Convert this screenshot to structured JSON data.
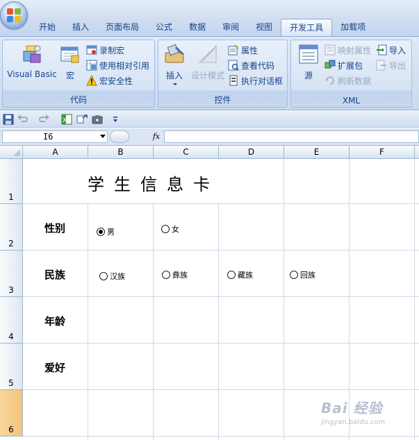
{
  "tabs": [
    "开始",
    "插入",
    "页面布局",
    "公式",
    "数据",
    "审阅",
    "视图",
    "开发工具",
    "加载项"
  ],
  "active_tab": "开发工具",
  "ribbon": {
    "code_group": {
      "label": "代码",
      "visual_basic": "Visual Basic",
      "macros": "宏",
      "record_macro": "录制宏",
      "relative_refs": "使用相对引用",
      "macro_security": "宏安全性"
    },
    "controls_group": {
      "label": "控件",
      "insert": "插入",
      "design_mode": "设计模式",
      "properties": "属性",
      "view_code": "查看代码",
      "run_dialog": "执行对话框"
    },
    "xml_group": {
      "label": "XML",
      "source": "源",
      "map_properties": "映射属性",
      "expansion_packs": "扩展包",
      "refresh_data": "刷新数据",
      "import": "导入",
      "export": "导出"
    }
  },
  "formula_bar": {
    "name_box": "I6",
    "fx": "fx",
    "formula": ""
  },
  "sheet": {
    "columns": [
      "A",
      "B",
      "C",
      "D",
      "E",
      "F"
    ],
    "rows": [
      "1",
      "2",
      "3",
      "4",
      "5",
      "6"
    ],
    "title": "学生信息卡",
    "labels": {
      "gender": "性别",
      "ethnicity": "民族",
      "age": "年龄",
      "hobby": "爱好"
    },
    "gender_options": [
      {
        "label": "男",
        "selected": true
      },
      {
        "label": "女",
        "selected": false
      }
    ],
    "ethnicity_options": [
      {
        "label": "汉族",
        "selected": false
      },
      {
        "label": "彝族",
        "selected": false
      },
      {
        "label": "藏族",
        "selected": false
      },
      {
        "label": "回族",
        "selected": false
      }
    ]
  },
  "watermark": {
    "logo": "Bai 经验",
    "url": "jingyan.baidu.com"
  }
}
